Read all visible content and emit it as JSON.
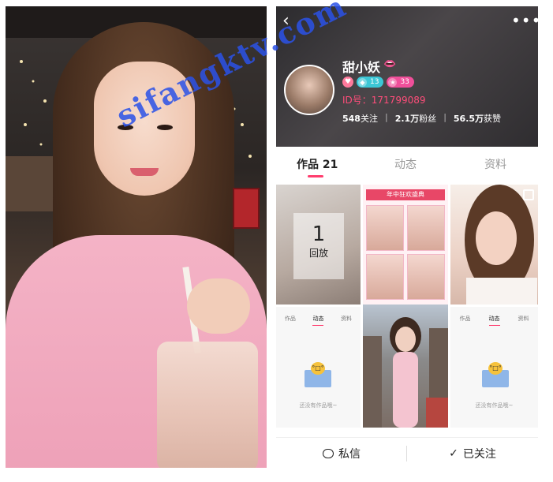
{
  "watermark": "sifangktv.com",
  "profile": {
    "nickname": "甜小妖",
    "badge_level_1": "13",
    "badge_level_2": "33",
    "user_id": "ID号：171799089",
    "stats": {
      "following": "548",
      "following_label": "关注",
      "fans": "2.1万",
      "fans_label": "粉丝",
      "likes": "56.5万",
      "likes_label": "获赞"
    }
  },
  "tabs": [
    {
      "label": "作品 21",
      "active": true
    },
    {
      "label": "动态",
      "active": false
    },
    {
      "label": "资料",
      "active": false
    }
  ],
  "grid": {
    "replay_count": "1",
    "replay_label": "回放",
    "event_banner": "年中狂欢盛典",
    "mini_tabs": [
      "作品",
      "动态",
      "资料"
    ],
    "empty_text": "还没有作品哦~"
  },
  "bottom_bar": {
    "message_label": "私信",
    "followed_label": "已关注"
  },
  "colors": {
    "accent_pink": "#ff3d6e",
    "id_pink": "#ff4d7a",
    "watermark_blue": "#2b52e8"
  }
}
